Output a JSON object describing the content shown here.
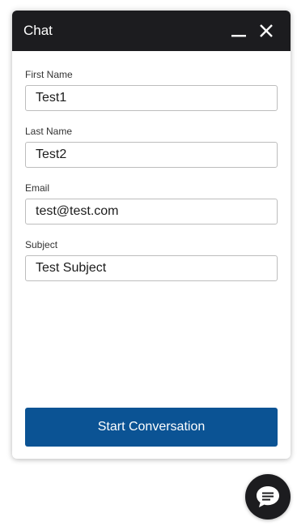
{
  "header": {
    "title": "Chat",
    "minimize_icon": "minimize-icon",
    "close_icon": "close-icon",
    "background": "#1c1c1f"
  },
  "form": {
    "fields": [
      {
        "label": "First Name",
        "value": "Test1"
      },
      {
        "label": "Last Name",
        "value": "Test2"
      },
      {
        "label": "Email",
        "value": "test@test.com"
      },
      {
        "label": "Subject",
        "value": "Test Subject"
      }
    ],
    "submit_label": "Start Conversation",
    "submit_color": "#0b5394"
  },
  "launcher": {
    "icon": "chat-bubble-icon"
  }
}
